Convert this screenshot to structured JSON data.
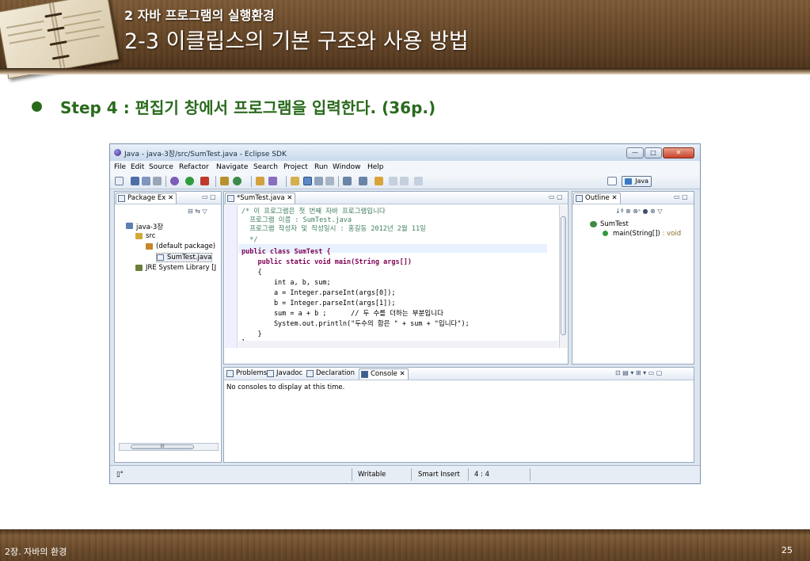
{
  "slide": {
    "section_label": "2 자바 프로그램의 실행환경",
    "title": "2-3 이클립스의 기본 구조와 사용 방법",
    "step_heading": "Step 4 : 편집기 창에서 프로그램을 입력한다. (36p.)",
    "footer_chapter": "2장. 자바의 환경",
    "page_number": "25",
    "accent_color": "#2a6a1d",
    "header_color": "#6a4a2a"
  },
  "eclipse": {
    "window_title": "Java - java-3장/src/SumTest.java - Eclipse SDK",
    "window_buttons": {
      "minimize": "—",
      "maximize": "□",
      "close": "✕"
    },
    "menu": [
      "File",
      "Edit",
      "Source",
      "Refactor",
      "Navigate",
      "Search",
      "Project",
      "Run",
      "Window",
      "Help"
    ],
    "perspective": "Java",
    "package_explorer": {
      "tab_label": "Package Ex",
      "tab_close": "✕",
      "view_buttons": "▭ ▢",
      "tree_tools": "⊟ ⇆ ▽",
      "items": [
        "java-3장",
        "src",
        "(default package)",
        "SumTest.java",
        "JRE System Library [J"
      ],
      "scroll_thumb": "III"
    },
    "editor": {
      "tab_label": "*SumTest.java",
      "tab_close": "✕",
      "view_buttons": "▭ ▢",
      "code_lines": [
        "/* 이 프로그램은 첫 번째 자바 프로그램입니다",
        "  프로그램 이름 : SumTest.java",
        "  프로그램 작성자 및 작성일시 : 홍길동 2012년 2월 11일",
        "  */",
        "public class SumTest {",
        "    public static void main(String args[])",
        "    {",
        "        int a, b, sum;",
        "        a = Integer.parseInt(args[0]);",
        "        b = Integer.parseInt(args[1]);",
        "        sum = a + b ;      // 두 수를 더하는 부분입니다",
        "        System.out.println(\"두수의 합은 \" + sum + \"입니다\");",
        "    }",
        "}"
      ]
    },
    "outline": {
      "tab_label": "Outline",
      "tab_close": "✕",
      "view_buttons": "▭ ▢",
      "tools": "↓ª ⊗ ⊗ˢ ● ⊗ ▽",
      "class_name": "SumTest",
      "method": "main(String[])",
      "method_type": " : void"
    },
    "console_view": {
      "tabs": [
        "Problems",
        "Javadoc",
        "Declaration",
        "Console"
      ],
      "active_tab": "Console",
      "tab_close": "✕",
      "view_buttons": "⊡ ▤ ▾ ⊞ ▾ ▭ ▢",
      "message": "No consoles to display at this time."
    },
    "status_bar": {
      "left_icon": "▯°",
      "writable": "Writable",
      "insert_mode": "Smart Insert",
      "position": "4 : 4"
    }
  }
}
